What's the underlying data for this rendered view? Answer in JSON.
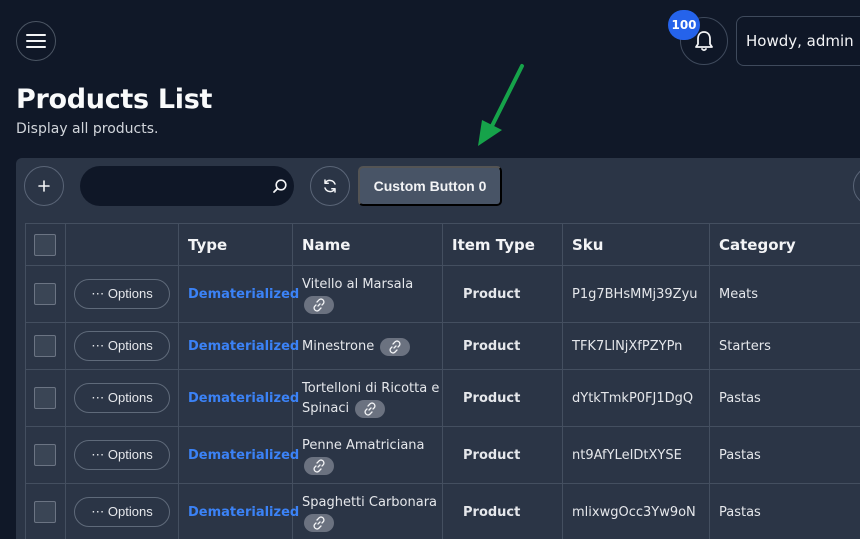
{
  "header": {
    "notification_count": "100",
    "user_greeting": "Howdy, admin"
  },
  "page": {
    "title": "Products List",
    "subtitle": "Display all products."
  },
  "toolbar": {
    "search_placeholder": "",
    "custom_button_label": "Custom Button 0"
  },
  "table": {
    "columns": [
      "",
      "",
      "Type",
      "Name",
      "Item Type",
      "Sku",
      "Category"
    ],
    "options_label": "⋯ Options",
    "rows": [
      {
        "type": "Dematerialized",
        "name": "Vitello al Marsala",
        "item_type": "Product",
        "sku": "P1g7BHsMMj39Zyu",
        "category": "Meats"
      },
      {
        "type": "Dematerialized",
        "name": "Minestrone",
        "item_type": "Product",
        "sku": "TFK7LlNjXfPZYPn",
        "category": "Starters"
      },
      {
        "type": "Dematerialized",
        "name": "Tortelloni di Ricotta e Spinaci",
        "item_type": "Product",
        "sku": "dYtkTmkP0FJ1DgQ",
        "category": "Pastas"
      },
      {
        "type": "Dematerialized",
        "name": "Penne Amatriciana",
        "item_type": "Product",
        "sku": "nt9AfYLeIDtXYSE",
        "category": "Pastas"
      },
      {
        "type": "Dematerialized",
        "name": "Spaghetti Carbonara",
        "item_type": "Product",
        "sku": "mlixwgOcc3Yw9oN",
        "category": "Pastas"
      }
    ]
  },
  "colors": {
    "background": "#101828",
    "panel": "#2b3546",
    "accent_blue": "#3b82f6",
    "badge_blue": "#2563eb",
    "arrow_green": "#16a34a"
  },
  "icons": [
    "hamburger-icon",
    "bell-icon",
    "plus-icon",
    "search-icon",
    "refresh-icon",
    "link-icon",
    "arrow-annotation"
  ]
}
